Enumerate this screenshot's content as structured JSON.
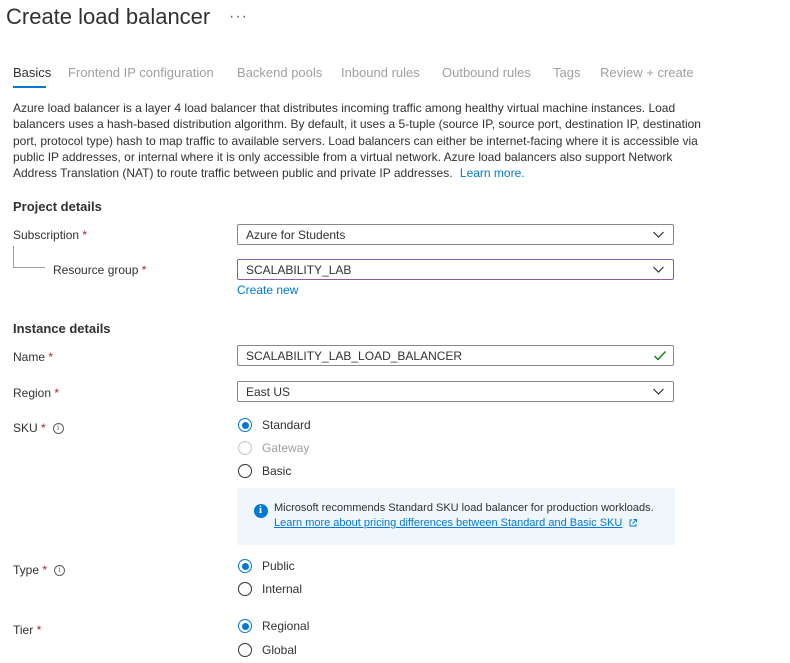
{
  "page": {
    "title": "Create load balancer",
    "more_label": "···"
  },
  "tabs": [
    {
      "label": "Basics",
      "active": true
    },
    {
      "label": "Frontend IP configuration"
    },
    {
      "label": "Backend pools"
    },
    {
      "label": "Inbound rules"
    },
    {
      "label": "Outbound rules"
    },
    {
      "label": "Tags"
    },
    {
      "label": "Review + create"
    }
  ],
  "description": {
    "text": "Azure load balancer is a layer 4 load balancer that distributes incoming traffic among healthy virtual machine instances. Load balancers uses a hash-based distribution algorithm. By default, it uses a 5-tuple (source IP, source port, destination IP, destination port, protocol type) hash to map traffic to available servers. Load balancers can either be internet-facing where it is accessible via public IP addresses, or internal where it is only accessible from a virtual network. Azure load balancers also support Network Address Translation (NAT) to route traffic between public and private IP addresses.",
    "learn_more": "Learn more."
  },
  "project_details": {
    "heading": "Project details",
    "subscription": {
      "label": "Subscription",
      "required_mark": "*",
      "value": "Azure for Students"
    },
    "resource_group": {
      "label": "Resource group",
      "required_mark": "*",
      "value": "SCALABILITY_LAB",
      "create_new": "Create new"
    }
  },
  "instance_details": {
    "heading": "Instance details",
    "name": {
      "label": "Name",
      "required_mark": "*",
      "value": "SCALABILITY_LAB_LOAD_BALANCER"
    },
    "region": {
      "label": "Region",
      "required_mark": "*",
      "value": "East US"
    },
    "sku": {
      "label": "SKU",
      "required_mark": "*",
      "options": [
        {
          "label": "Standard",
          "selected": true
        },
        {
          "label": "Gateway",
          "disabled": true
        },
        {
          "label": "Basic"
        }
      ],
      "info": {
        "text": "Microsoft recommends Standard SKU load balancer for production workloads.",
        "link": "Learn more about pricing differences between Standard and Basic SKU"
      }
    },
    "type": {
      "label": "Type",
      "required_mark": "*",
      "options": [
        {
          "label": "Public",
          "selected": true
        },
        {
          "label": "Internal"
        }
      ]
    },
    "tier": {
      "label": "Tier",
      "required_mark": "*",
      "options": [
        {
          "label": "Regional",
          "selected": true
        },
        {
          "label": "Global"
        }
      ]
    }
  },
  "colors": {
    "accent": "#0078d4",
    "required": "#a4262c",
    "valid": "#107c10",
    "focus_border": "#8a5bad",
    "info_bg": "#eff6fc"
  }
}
